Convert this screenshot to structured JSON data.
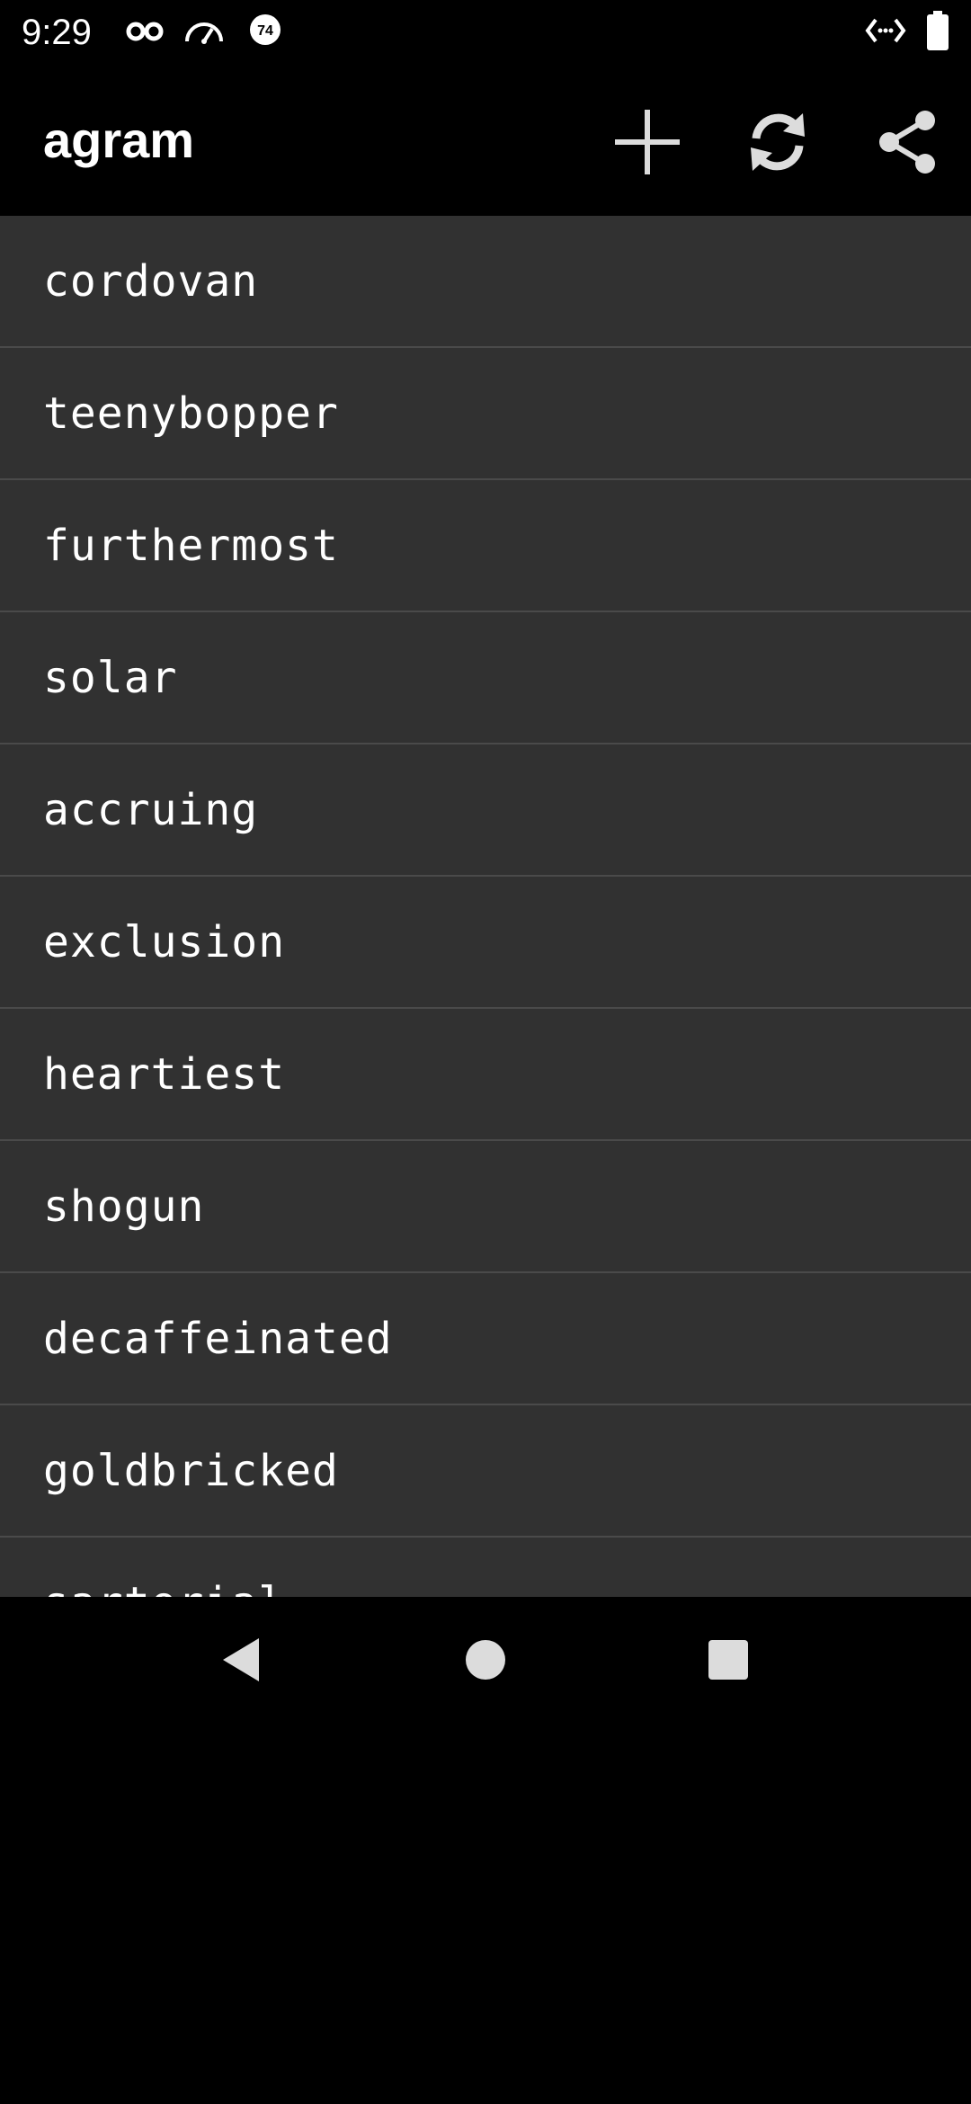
{
  "status_bar": {
    "time": "9:29",
    "icons": [
      "incognito-icon",
      "speedometer-icon",
      "notification-badge-icon",
      "code-icon",
      "battery-icon"
    ],
    "badge_text": "74"
  },
  "app_bar": {
    "title": "agram",
    "actions": [
      "add-icon",
      "refresh-icon",
      "share-icon"
    ]
  },
  "words": [
    "cordovan",
    "teenybopper",
    "furthermost",
    "solar",
    "accruing",
    "exclusion",
    "heartiest",
    "shogun",
    "decaffeinated",
    "goldbricked",
    "sartorial"
  ],
  "nav_bar": {
    "buttons": [
      "back-icon",
      "home-icon",
      "recents-icon"
    ]
  },
  "colors": {
    "list_background": "#313131",
    "divider": "#4a4a4a",
    "app_bar": "#000000",
    "icon": "#dcdcdc"
  }
}
